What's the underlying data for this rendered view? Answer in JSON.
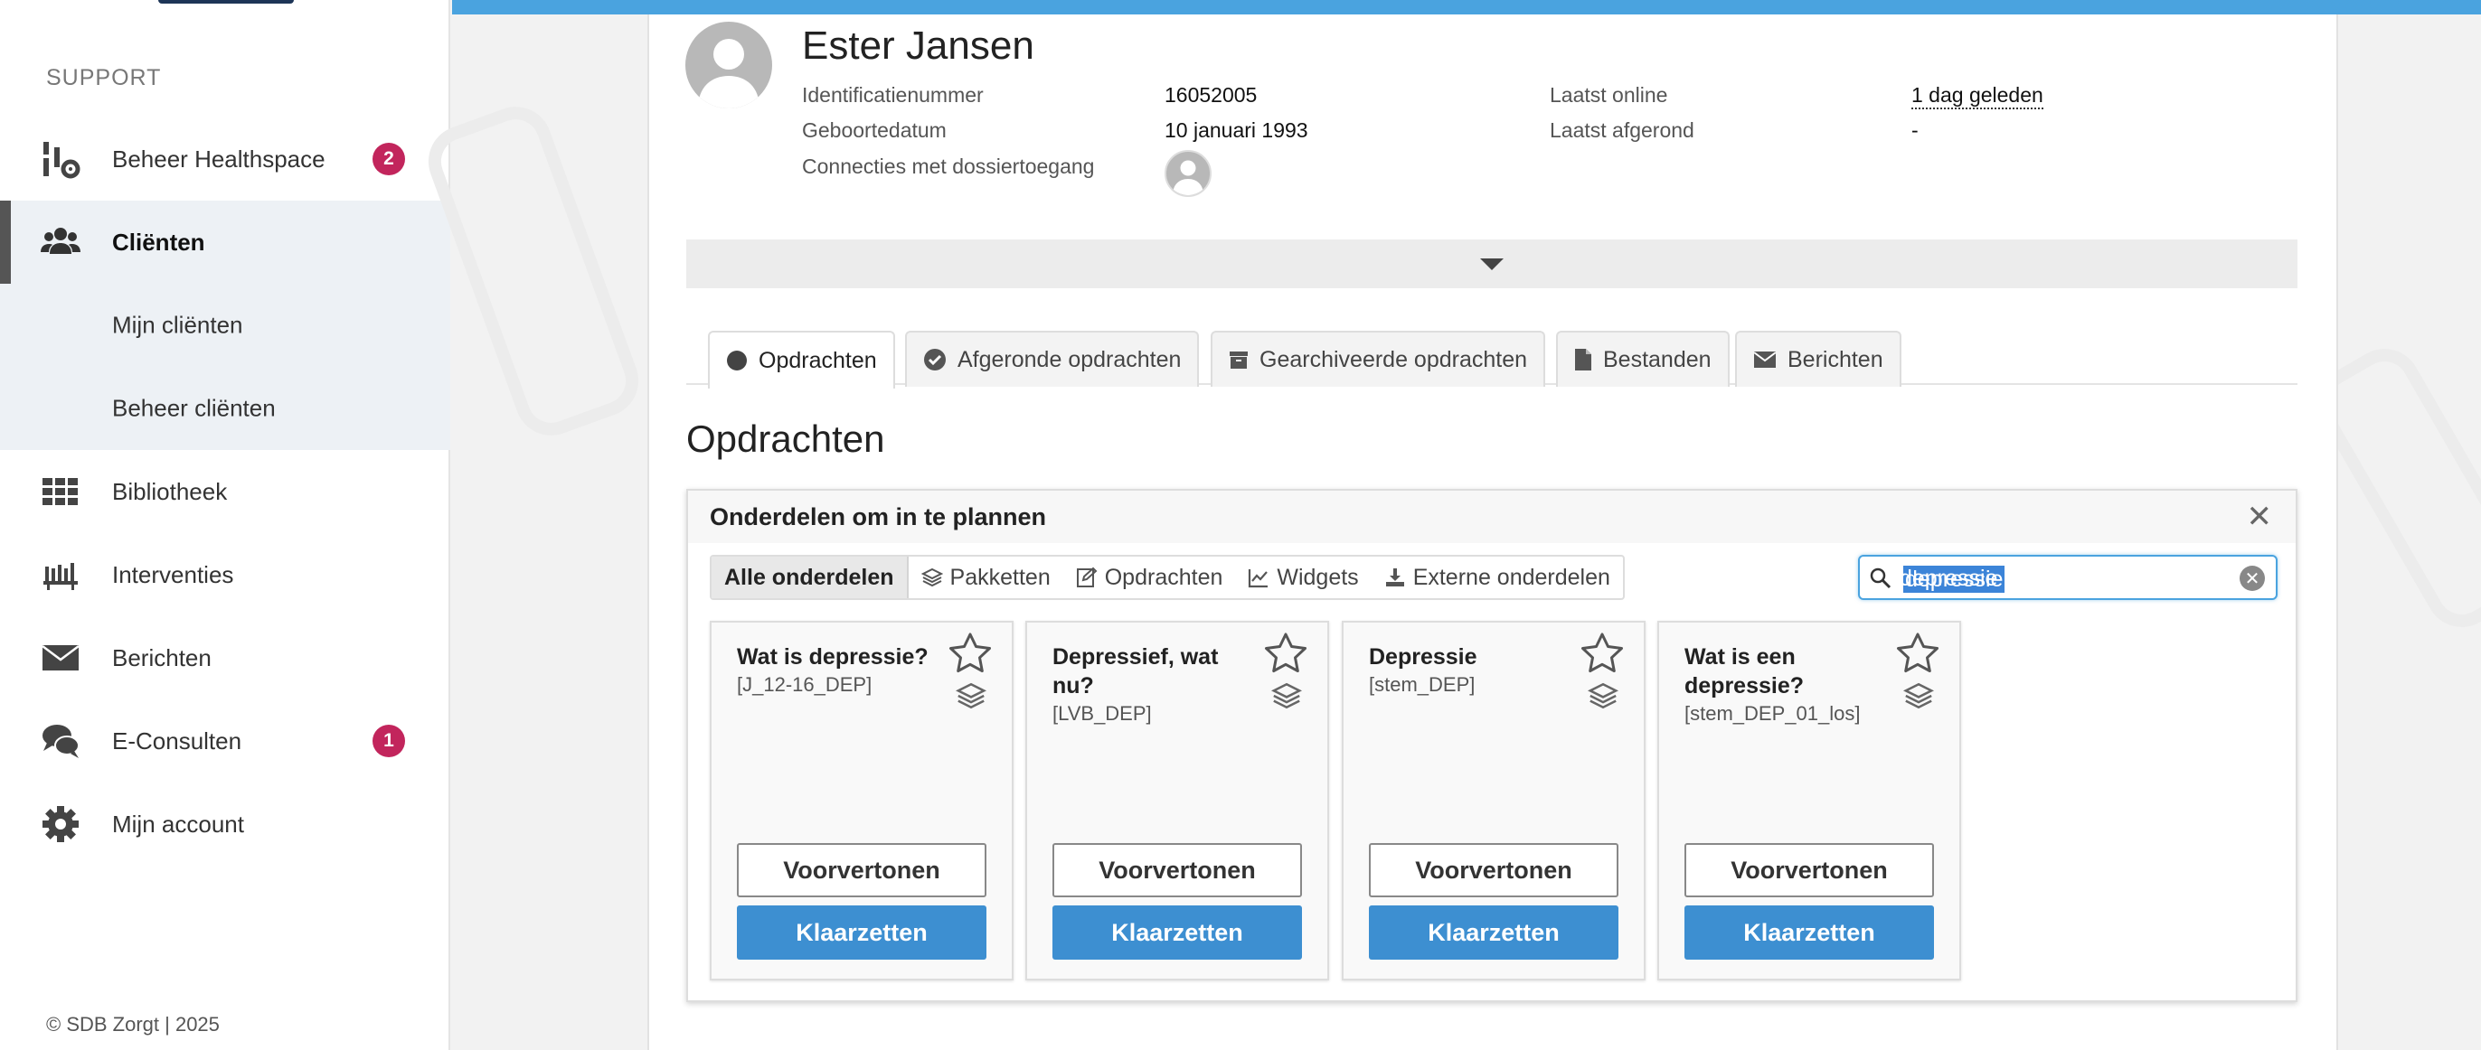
{
  "sidebar": {
    "section_title": "SUPPORT",
    "items": [
      {
        "label": "Beheer Healthspace",
        "icon": "healthspace-admin-icon",
        "badge": "2"
      },
      {
        "label": "Cliënten",
        "icon": "users-icon"
      },
      {
        "label": "Mijn cliënten"
      },
      {
        "label": "Beheer cliënten"
      },
      {
        "label": "Bibliotheek",
        "icon": "grid-icon"
      },
      {
        "label": "Interventies",
        "icon": "interventions-icon"
      },
      {
        "label": "Berichten",
        "icon": "envelope-icon"
      },
      {
        "label": "E-Consulten",
        "icon": "chat-icon",
        "badge": "1"
      },
      {
        "label": "Mijn account",
        "icon": "gear-icon"
      }
    ],
    "footer": "© SDB Zorgt | 2025"
  },
  "client": {
    "name": "Ester Jansen",
    "id_label": "Identificatienummer",
    "id_value": "16052005",
    "dob_label": "Geboortedatum",
    "dob_value": "10 januari 1993",
    "connections_label": "Connecties met dossiertoegang",
    "last_online_label": "Laatst online",
    "last_online_value": "1 dag geleden",
    "last_completed_label": "Laatst afgerond",
    "last_completed_value": "-"
  },
  "tabs": [
    {
      "label": "Opdrachten",
      "icon": "dot-icon",
      "active": true
    },
    {
      "label": "Afgeronde opdrachten",
      "icon": "check-circle-icon"
    },
    {
      "label": "Gearchiveerde opdrachten",
      "icon": "archive-icon"
    },
    {
      "label": "Bestanden",
      "icon": "file-icon"
    },
    {
      "label": "Berichten",
      "icon": "envelope-icon"
    }
  ],
  "section_title": "Opdrachten",
  "planner": {
    "title": "Onderdelen om in te plannen",
    "filters": [
      {
        "label": "Alle onderdelen",
        "active": true
      },
      {
        "label": "Pakketten",
        "icon": "layers-icon"
      },
      {
        "label": "Opdrachten",
        "icon": "edit-icon"
      },
      {
        "label": "Widgets",
        "icon": "chart-line-icon"
      },
      {
        "label": "Externe onderdelen",
        "icon": "import-icon"
      }
    ],
    "search": {
      "value": "depressie",
      "placeholder": ""
    },
    "cards": [
      {
        "title": "Wat is depressie?",
        "code": "[J_12-16_DEP]"
      },
      {
        "title": "Depressief, wat nu?",
        "code": "[LVB_DEP]"
      },
      {
        "title": "Depressie",
        "code": "[stem_DEP]"
      },
      {
        "title": "Wat is een depressie?",
        "code": "[stem_DEP_01_los]"
      }
    ],
    "preview_label": "Voorvertonen",
    "ready_label": "Klaarzetten"
  },
  "colors": {
    "accent": "#4aa3df",
    "primary_button": "#3d8fd1",
    "badge": "#c2255c"
  }
}
